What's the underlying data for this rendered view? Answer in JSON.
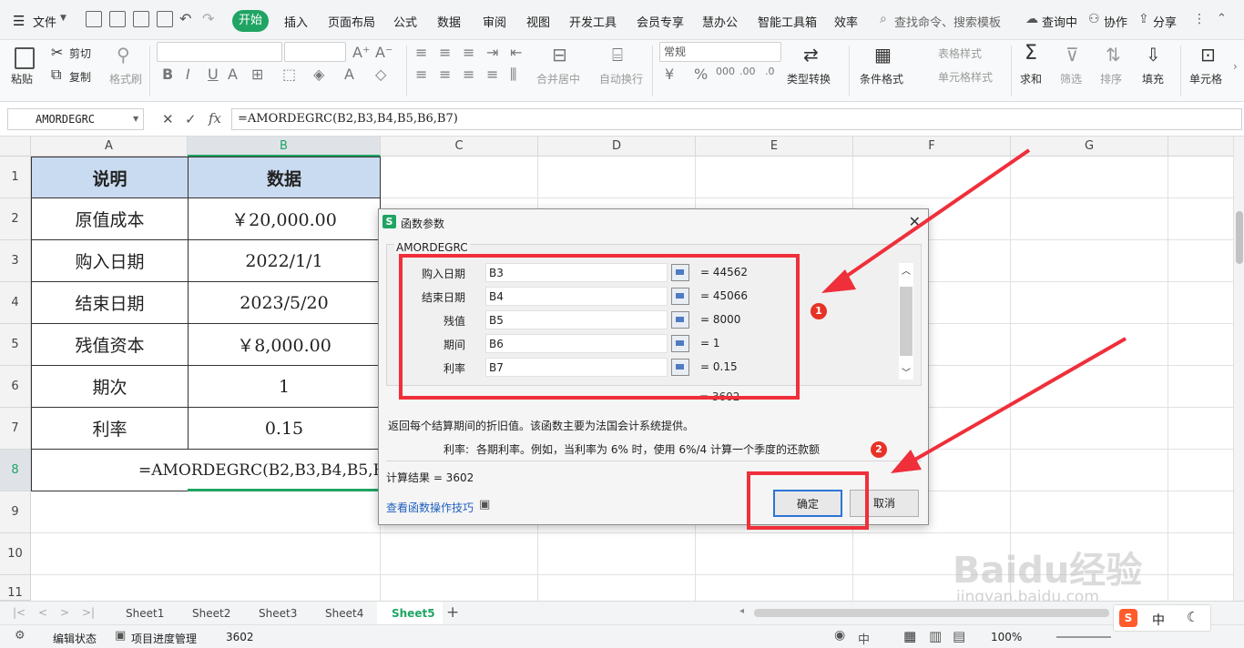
{
  "menubar": {
    "file": "文件",
    "tabs": [
      "开始",
      "插入",
      "页面布局",
      "公式",
      "数据",
      "审阅",
      "视图",
      "开发工具",
      "会员专享",
      "慧办公",
      "智能工具箱",
      "效率"
    ],
    "search": "查找命令、搜索模板",
    "right": [
      "查询中",
      "协作",
      "分享"
    ]
  },
  "ribbon": {
    "paste": "粘贴",
    "cut": "剪切",
    "copy": "复制",
    "format_painter": "格式刷",
    "merge": "合并居中",
    "wrap": "自动换行",
    "number_format": "常规",
    "type_convert": "类型转换",
    "cond_format": "条件格式",
    "table_style": "表格样式",
    "cell_style": "单元格样式",
    "sum": "求和",
    "filter": "筛选",
    "sort": "排序",
    "fill": "填充",
    "cell": "单元格"
  },
  "formula_bar": {
    "name_box": "AMORDEGRC",
    "fx": "fx",
    "formula": "=AMORDEGRC(B2,B3,B4,B5,B6,B7)"
  },
  "columns": [
    "A",
    "B",
    "C",
    "D",
    "E",
    "F",
    "G"
  ],
  "rows": [
    "1",
    "2",
    "3",
    "4",
    "5",
    "6",
    "7",
    "8",
    "9",
    "10",
    "11"
  ],
  "table": {
    "header": [
      "说明",
      "数据"
    ],
    "rows": [
      [
        "原值成本",
        "￥20,000.00"
      ],
      [
        "购入日期",
        "2022/1/1"
      ],
      [
        "结束日期",
        "2023/5/20"
      ],
      [
        "残值资本",
        "￥8,000.00"
      ],
      [
        "期次",
        "1"
      ],
      [
        "利率",
        "0.15"
      ]
    ],
    "formula_cell": "=AMORDEGRC(B2,B3,B4,B5,B"
  },
  "dialog": {
    "title": "函数参数",
    "function": "AMORDEGRC",
    "args": [
      {
        "name": "购入日期",
        "ref": "B3",
        "value": "= 44562"
      },
      {
        "name": "结束日期",
        "ref": "B4",
        "value": "= 45066"
      },
      {
        "name": "残值",
        "ref": "B5",
        "value": "= 8000"
      },
      {
        "name": "期间",
        "ref": "B6",
        "value": "= 1"
      },
      {
        "name": "利率",
        "ref": "B7",
        "value": "= 0.15"
      }
    ],
    "partial_result": "= 3602",
    "description": "返回每个结算期间的折旧值。该函数主要为法国会计系统提供。",
    "arg_desc_label": "利率:",
    "arg_desc": "各期利率。例如，当利率为 6% 时，使用 6%/4 计算一个季度的还款额",
    "calc_result": "计算结果 = 3602",
    "tips_link": "查看函数操作技巧",
    "ok": "确定",
    "cancel": "取消"
  },
  "annotations": {
    "badge1": "1",
    "badge2": "2",
    "accent": "#ef2f3a"
  },
  "sheets": [
    "Sheet1",
    "Sheet2",
    "Sheet3",
    "Sheet4",
    "Sheet5"
  ],
  "status": {
    "mode": "编辑状态",
    "project": "项目进度管理",
    "sum": "3602",
    "zoom": "100%",
    "ime": "中"
  },
  "watermark": {
    "brand": "Baidu经验",
    "url": "jingyan.baidu.com"
  }
}
